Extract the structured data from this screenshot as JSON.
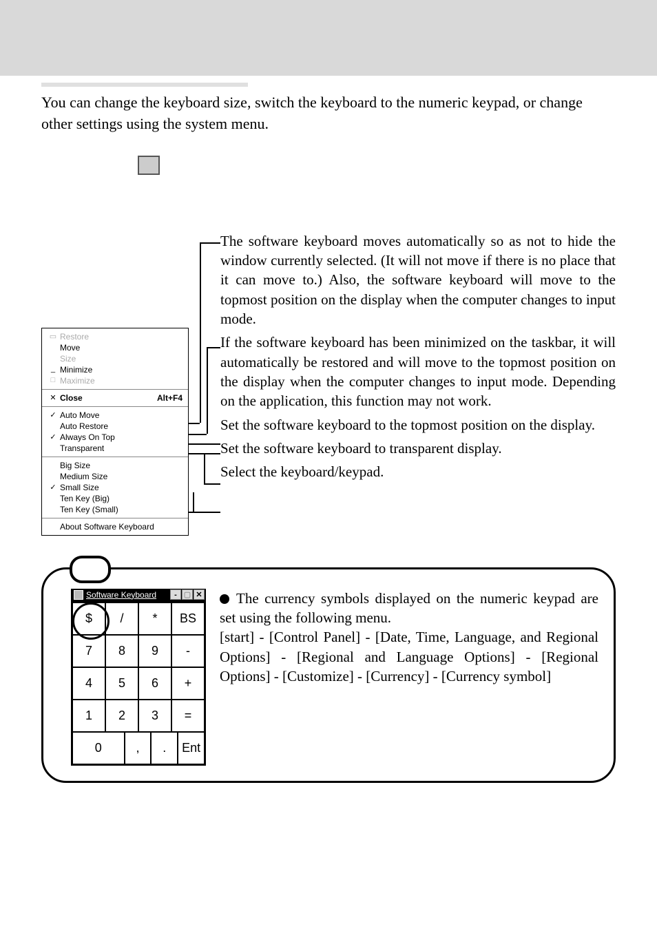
{
  "intro": "You can change the keyboard size, switch the keyboard to the numeric keypad, or change other settings using the system menu.",
  "explanations": {
    "e1": "The software keyboard moves automatically so as not to hide the window currently selected. (It will not move if there is no place that it can move to.)  Also, the software keyboard will move to the topmost position on the display when the computer changes to input mode.",
    "e2": "If the software keyboard has been minimized on the taskbar, it will automatically be restored and will move to the topmost position on the display when the computer changes to input mode.  Depending on the application, this function may not work.",
    "e3": "Set the software keyboard to the topmost position on the display.",
    "e4": "Set the software keyboard to transparent display.",
    "e5": "Select the keyboard/keypad."
  },
  "menu": {
    "restore": "Restore",
    "move": "Move",
    "size": "Size",
    "minimize": "Minimize",
    "maximize": "Maximize",
    "close": "Close",
    "close_shortcut": "Alt+F4",
    "auto_move": "Auto Move",
    "auto_restore": "Auto Restore",
    "always_on_top": "Always On Top",
    "transparent": "Transparent",
    "big_size": "Big Size",
    "medium_size": "Medium Size",
    "small_size": "Small Size",
    "ten_key_big": "Ten Key (Big)",
    "ten_key_small": "Ten Key (Small)",
    "about": "About Software Keyboard"
  },
  "note": {
    "p1": "The currency symbols displayed on the numeric keypad are set using the following menu.",
    "p2": "[start] - [Control Panel] - [Date, Time, Language, and Regional Options] - [Regional and Language Options] - [Regional Options] - [Customize] - [Currency] - [Currency symbol]"
  },
  "keypad": {
    "title": "Software Keyboard",
    "keys": {
      "dollar": "$",
      "slash": "/",
      "star": "*",
      "bs": "BS",
      "k7": "7",
      "k8": "8",
      "k9": "9",
      "minus": "-",
      "k4": "4",
      "k5": "5",
      "k6": "6",
      "plus": "+",
      "k1": "1",
      "k2": "2",
      "k3": "3",
      "eq": "=",
      "k0": "0",
      "comma": ",",
      "dot": ".",
      "ent": "Ent"
    }
  }
}
